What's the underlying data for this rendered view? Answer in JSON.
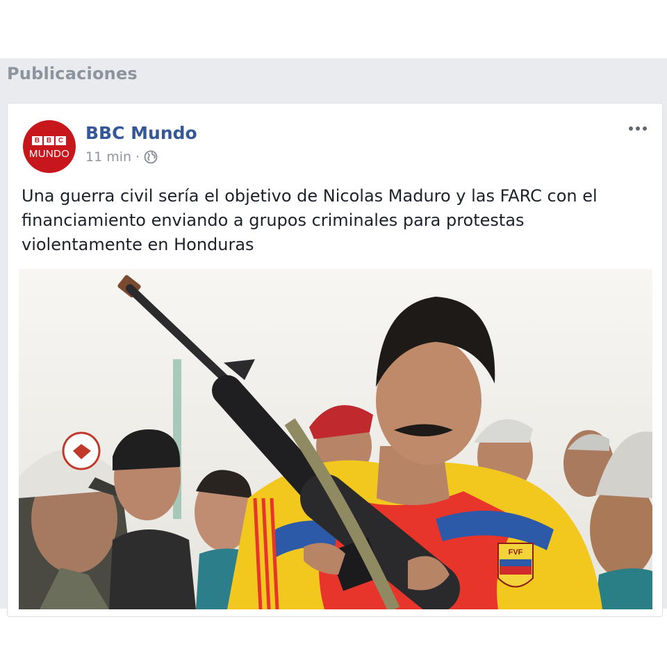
{
  "section": {
    "title": "Publicaciones"
  },
  "post": {
    "author": "BBC Mundo",
    "avatar": {
      "logo_letters": [
        "B",
        "B",
        "C"
      ],
      "logo_word": "MUNDO",
      "color": "#c8161d"
    },
    "time": "11 min",
    "separator": "·",
    "privacy_icon": "globe-icon",
    "options_icon": "more-options-icon",
    "text": "Una guerra civil sería el objetivo de Nicolas Maduro y las FARC con el financiamiento enviando a grupos criminales para protestas violentamente en Honduras",
    "image": {
      "jacket_badge": "FVF"
    }
  },
  "colors": {
    "link": "#365899",
    "meta": "#90949c",
    "band": "#e9ebee"
  }
}
